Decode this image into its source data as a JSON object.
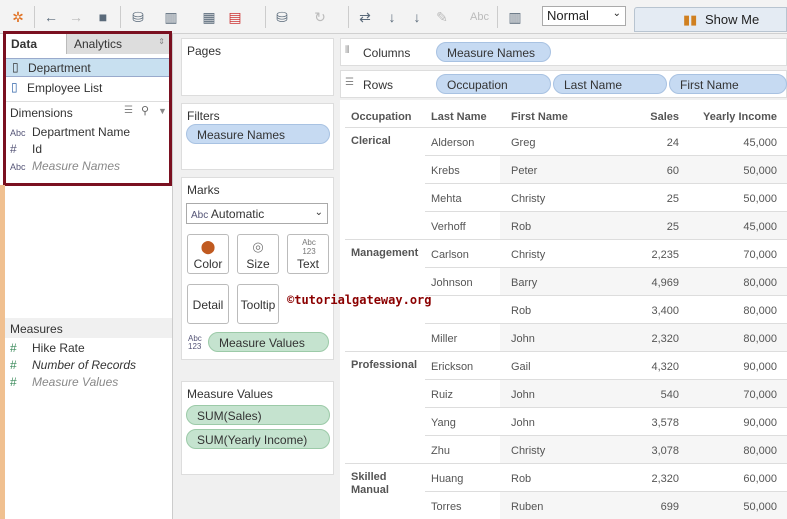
{
  "toolbar": {
    "fit_value": "Normal",
    "show_me": "Show Me"
  },
  "left_panel": {
    "tabs": [
      "Data",
      "Analytics"
    ],
    "datasources": [
      "Department",
      "Employee List"
    ],
    "dimensions_label": "Dimensions",
    "dimensions": [
      {
        "type": "Abc",
        "name": "Department Name"
      },
      {
        "type": "#",
        "name": "Id"
      },
      {
        "type": "Abc",
        "name": "Measure Names"
      }
    ],
    "measures_label": "Measures",
    "measures": [
      {
        "name": "Hike Rate"
      },
      {
        "name": "Number of Records"
      },
      {
        "name": "Measure Values"
      }
    ]
  },
  "shelves": {
    "pages": "Pages",
    "filters": "Filters",
    "filter_pill": "Measure Names",
    "marks": "Marks",
    "mark_type": "Automatic",
    "mark_type_icon": "Abc",
    "mark_buttons": [
      "Color",
      "Size",
      "Text",
      "Detail",
      "Tooltip"
    ],
    "text_glyph": "Abc 123",
    "marks_pill": "Measure Values",
    "measure_values_label": "Measure Values",
    "measure_values": [
      "SUM(Sales)",
      "SUM(Yearly Income)"
    ],
    "columns_label": "Columns",
    "columns": [
      "Measure Names"
    ],
    "rows_label": "Rows",
    "rows": [
      "Occupation",
      "Last Name",
      "First Name"
    ]
  },
  "watermark": "©tutorialgateway.org",
  "table": {
    "headers": [
      "Occupation",
      "Last Name",
      "First Name",
      "Sales",
      "Yearly Income"
    ],
    "rows": [
      [
        "Clerical",
        "Alderson",
        "Greg",
        "24",
        "45,000"
      ],
      [
        "",
        "Krebs",
        "Peter",
        "60",
        "50,000"
      ],
      [
        "",
        "Mehta",
        "Christy",
        "25",
        "50,000"
      ],
      [
        "",
        "Verhoff",
        "Rob",
        "25",
        "45,000"
      ],
      [
        "Management",
        "Carlson",
        "Christy",
        "2,235",
        "70,000"
      ],
      [
        "",
        "Johnson",
        "Barry",
        "4,969",
        "80,000"
      ],
      [
        "",
        "",
        "Rob",
        "3,400",
        "80,000"
      ],
      [
        "",
        "Miller",
        "John",
        "2,320",
        "80,000"
      ],
      [
        "Professional",
        "Erickson",
        "Gail",
        "4,320",
        "90,000"
      ],
      [
        "",
        "Ruiz",
        "John",
        "540",
        "70,000"
      ],
      [
        "",
        "Yang",
        "John",
        "3,578",
        "90,000"
      ],
      [
        "",
        "Zhu",
        "Christy",
        "3,078",
        "80,000"
      ],
      [
        "Skilled Manual",
        "Huang",
        "Rob",
        "2,320",
        "60,000"
      ],
      [
        "",
        "Torres",
        "Ruben",
        "699",
        "50,000"
      ]
    ]
  }
}
